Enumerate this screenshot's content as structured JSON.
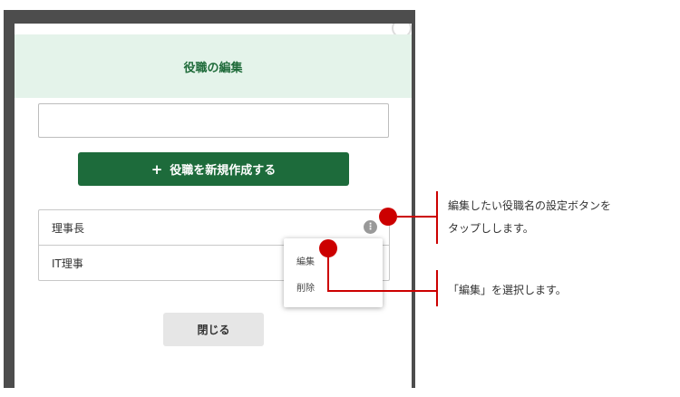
{
  "dialog": {
    "title": "役職の編集",
    "input": {
      "value": "",
      "placeholder": ""
    },
    "create_button": {
      "icon": "plus-icon",
      "label": "役職を新規作成する"
    },
    "roles": [
      {
        "name": "理事長",
        "settings_icon": "more-vertical-icon"
      },
      {
        "name": "IT理事"
      }
    ],
    "menu": {
      "items": [
        "編集",
        "削除"
      ]
    },
    "close_button": "閉じる"
  },
  "annotations": {
    "note_1": {
      "line1": "編集したい役職名の設定ボタンを",
      "line2": "タップしします。"
    },
    "note_2": "「編集」を選択します。",
    "marker_color": "#cc0000"
  },
  "colors": {
    "frame": "#4d4d4d",
    "header_bg": "#e4f3ea",
    "title": "#1f6b3a",
    "primary_button": "#1d6b3b",
    "secondary_button": "#e6e6e6"
  }
}
